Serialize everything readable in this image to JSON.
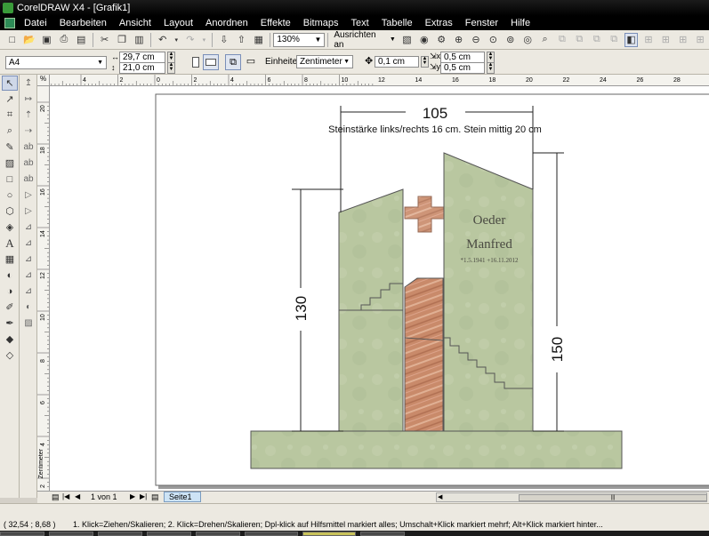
{
  "window": {
    "title": "CorelDRAW X4 - [Grafik1]"
  },
  "menu": [
    {
      "label": "Datei"
    },
    {
      "label": "Bearbeiten"
    },
    {
      "label": "Ansicht"
    },
    {
      "label": "Layout"
    },
    {
      "label": "Anordnen"
    },
    {
      "label": "Effekte"
    },
    {
      "label": "Bitmaps"
    },
    {
      "label": "Text"
    },
    {
      "label": "Tabelle"
    },
    {
      "label": "Extras"
    },
    {
      "label": "Fenster"
    },
    {
      "label": "Hilfe"
    }
  ],
  "toolbar": {
    "zoom_value": "130%",
    "align_label": "Ausrichten an"
  },
  "propertybar": {
    "page_size": "A4",
    "width": "29,7 cm",
    "height": "21,0 cm",
    "units_label": "Einheiten:",
    "units_value": "Zentimeter",
    "nudge": "0,1 cm",
    "dup_x": "0,5 cm",
    "dup_y": "0,5 cm"
  },
  "ruler": {
    "h_ticks": [
      "4",
      "2",
      "0",
      "2",
      "4",
      "6",
      "8",
      "10",
      "12",
      "14",
      "16",
      "18",
      "20",
      "22",
      "24",
      "26",
      "28"
    ],
    "v_ticks": [
      "20",
      "18",
      "16",
      "14",
      "12",
      "10",
      "8",
      "6",
      "4",
      "2"
    ],
    "v_unit": "Zentimeter",
    "corner": "%"
  },
  "drawing": {
    "dim_top": "105",
    "subtitle": "Steinstärke links/rechts 16 cm. Stein mittig 20 cm",
    "dim_left": "130",
    "dim_right": "150",
    "name_first": "Oeder",
    "name_last": "Manfred",
    "dates": "*1.5.1941  +16.11.2012",
    "colors": {
      "stone": "#b9c7a0",
      "stone_dark": "#a8b68e",
      "granite": "#c98a6a",
      "cross": "#d9a585",
      "outline": "#555"
    }
  },
  "pagenav": {
    "page_count": "1 von 1",
    "page_tab": "Seite1"
  },
  "status": {
    "coords": "( 32,54 ; 8,68 )",
    "hint": "1. Klick=Ziehen/Skalieren; 2. Klick=Drehen/Skalieren; Dpl-klick auf Hilfsmittel markiert alles; Umschalt+Klick markiert mehrf; Alt+Klick markiert hinter..."
  }
}
